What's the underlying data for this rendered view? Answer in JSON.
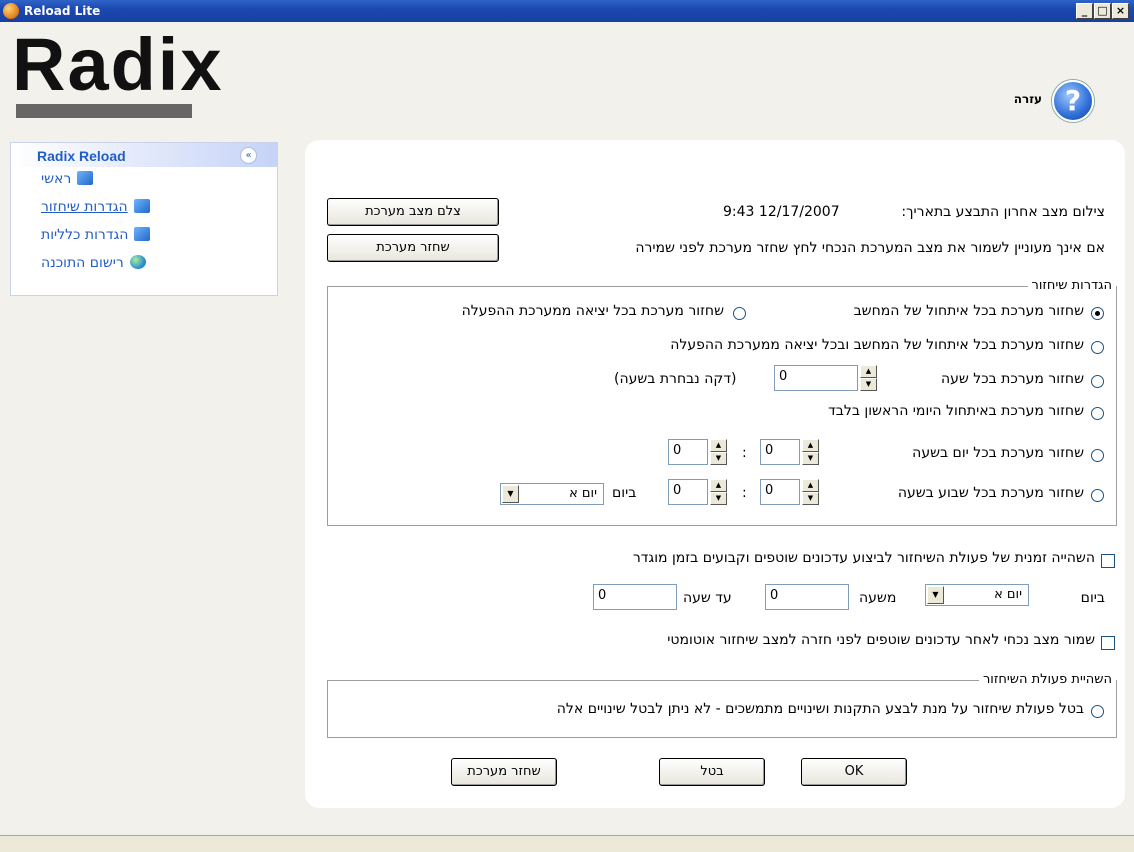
{
  "window": {
    "title": "Reload Lite",
    "min": "_",
    "max": "□",
    "close": "×"
  },
  "logo": {
    "text": "Radix"
  },
  "help": {
    "label": "עזרה",
    "glyph": "?"
  },
  "sidebar": {
    "title": "Radix Reload",
    "collapse_glyph": "«",
    "items": [
      {
        "label": "ראשי"
      },
      {
        "label": "הגדרות שיחזור"
      },
      {
        "label": "הגדרות כלליות"
      },
      {
        "label": "רישום התוכנה"
      }
    ]
  },
  "snapshot": {
    "label": "צילום מצב אחרון התבצע בתאריך:",
    "datetime": "12/17/2007 9:43",
    "button": "צלם מצב מערכת"
  },
  "restore_note": {
    "text": "אם אינך מעוניין לשמור את מצב המערכת הנכחי לחץ שחזר מערכת לפני שמירה",
    "button": "שחזר מערכת"
  },
  "restore_settings": {
    "legend": "הגדרות שיחזור",
    "opt_boot": "שחזור מערכת בכל איתחול של המחשב",
    "opt_exit": "שחזור מערכת בכל יציאה ממערכת ההפעלה",
    "opt_both": "שחזור מערכת בכל איתחול של המחשב ובכל יציאה ממערכת ההפעלה",
    "opt_hourly": "שחזור מערכת בכל שעה",
    "hourly_value": "0",
    "hourly_note": "(דקה נבחרת בשעה)",
    "opt_daily_first": "שחזור מערכת באיתחול היומי הראשון בלבד",
    "opt_daily": "שחזור מערכת בכל יום בשעה",
    "daily_hour": "0",
    "daily_min": "0",
    "colon": ":",
    "opt_weekly": "שחזור מערכת בכל שבוע בשעה",
    "weekly_hour": "0",
    "weekly_min": "0",
    "weekly_day_label": "ביום",
    "weekly_day_value": "יום א"
  },
  "suspend": {
    "label": "השהייה זמנית של פעולת השיחזור לביצוע עדכונים שוטפים וקבועים בזמן מוגדר",
    "day_label": "ביום",
    "day_value": "יום א",
    "from_label": "משעה",
    "from_value": "0",
    "to_label": "עד שעה",
    "to_value": "0"
  },
  "keep_state": {
    "label": "שמור מצב נכחי לאחר עדכונים שוטפים לפני חזרה למצב שיחזור אוטומטי"
  },
  "suspend_restore": {
    "legend": "השהיית פעולת השיחזור",
    "option": "בטל פעולת שיחזור על מנת לבצע התקנות ושינויים מתמשכים - לא ניתן לבטל שינויים אלה"
  },
  "footer": {
    "restore": "שחזר מערכת",
    "cancel": "בטל",
    "ok": "OK"
  }
}
